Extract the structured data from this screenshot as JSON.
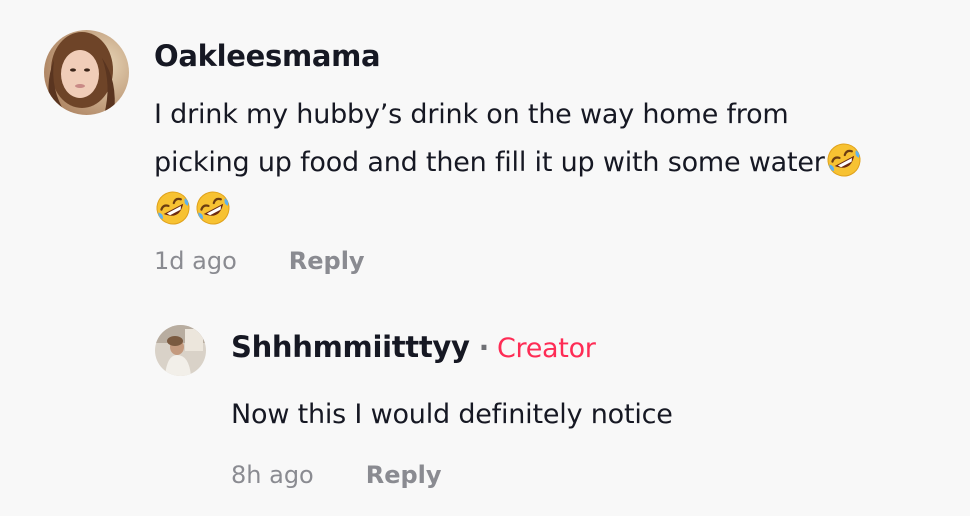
{
  "comments": [
    {
      "username": "Oakleesmama",
      "text_line1": "I drink my hubby’s drink on the way home from",
      "text_line2": "picking up food and then fill it up with some water",
      "emojis": [
        "rolling-on-floor-laughing",
        "rolling-on-floor-laughing",
        "rolling-on-floor-laughing"
      ],
      "time": "1d ago",
      "reply_label": "Reply",
      "avatar": "avatar-woman-photo"
    }
  ],
  "reply": {
    "username": "Shhhmmiitttyy",
    "separator": "·",
    "badge": "Creator",
    "text": "Now this I would definitely notice",
    "time": "8h ago",
    "reply_label": "Reply",
    "avatar": "avatar-small-photo"
  },
  "colors": {
    "background": "#f8f8f8",
    "text": "#161823",
    "muted": "#8a8b91",
    "creator_badge": "#fe2c55"
  }
}
